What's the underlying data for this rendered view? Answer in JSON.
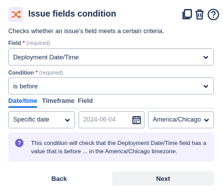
{
  "header": {
    "title": "Issue fields condition",
    "accent_color": "#6e5dc6"
  },
  "description": "Checks whether an issue's field meets a certain criteria.",
  "field": {
    "label": "Field",
    "required_mark": "*",
    "required_hint": "(required)",
    "value": "Deployment Date/Time"
  },
  "condition": {
    "label": "Condition",
    "required_mark": "*",
    "required_hint": "(required)",
    "value": "is before"
  },
  "tabs": [
    {
      "label": "Date/time",
      "active": true
    },
    {
      "label": "Timeframe",
      "active": false
    },
    {
      "label": "Field",
      "active": false
    }
  ],
  "datetime": {
    "type_value": "Specific date",
    "date_placeholder": "2024-06-04",
    "timezone_value": "America/Chicago"
  },
  "info": {
    "icon": "question-circle-icon",
    "text": "This condition will check that the Deployment Date/Time field has a value that is before ... in the America/Chicago timezone."
  },
  "footer": {
    "back_label": "Back",
    "next_label": "Next"
  }
}
